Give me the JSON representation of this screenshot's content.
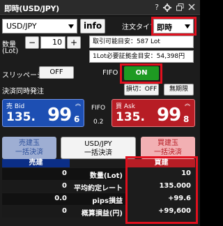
{
  "window": {
    "title": "即時(USD/JPY)"
  },
  "titlebar_icons": [
    "help-icon",
    "settings-icon",
    "restore-icon",
    "close-icon"
  ],
  "symbol_select": {
    "value": "USD/JPY"
  },
  "info_button": {
    "label": "info"
  },
  "order_type": {
    "label": "注文タイプ",
    "value": "即時"
  },
  "quantity": {
    "label_line1": "数量",
    "label_line2": "(Lot)",
    "minus": "−",
    "value": "10",
    "plus": "+"
  },
  "tradable_amount": "取引可能目安：587 Lot",
  "margin_per_lot": "1Lot必要証拠金目安：54,398円",
  "slippage": {
    "label": "スリッページ",
    "value": "OFF"
  },
  "fifo": {
    "label": "FIFO",
    "value": "ON"
  },
  "settle_order": {
    "label": "決済同時発注",
    "stop_loss": "損切：OFF",
    "unlimited": "無期限"
  },
  "bid": {
    "label": "売 Bid",
    "prefix": "135.",
    "digits": "99",
    "last_digit": "6"
  },
  "ask": {
    "label": "買 Ask",
    "prefix": "135.",
    "digits": "99",
    "last_digit": "8"
  },
  "fifo_spread": {
    "label": "FIFO",
    "value": "0.2"
  },
  "bulk_buttons": {
    "sell": {
      "line1": "売建玉",
      "line2": "一括決済"
    },
    "pair": {
      "line1": "USD/JPY",
      "line2": "一括決済"
    },
    "buy": {
      "line1": "買建玉",
      "line2": "一括決済"
    }
  },
  "table": {
    "sell_header": "売建",
    "buy_header": "買建",
    "rows": [
      {
        "sell": "0",
        "label": "数量(Lot)",
        "buy": "10"
      },
      {
        "sell": "0",
        "label": "平均約定レート",
        "buy": "135.000"
      },
      {
        "sell": "0.0",
        "label": "pips損益",
        "buy": "+99.6"
      },
      {
        "sell": "0",
        "label": "概算損益(円)",
        "buy": "+99,600"
      }
    ]
  },
  "colors": {
    "bid_bg": "#1d4fb3",
    "ask_bg": "#b71d25",
    "fifo_on": "#1e9a22",
    "highlight": "#e0101e",
    "sell_header": "#0b2e86",
    "buy_header": "#b71d25"
  }
}
